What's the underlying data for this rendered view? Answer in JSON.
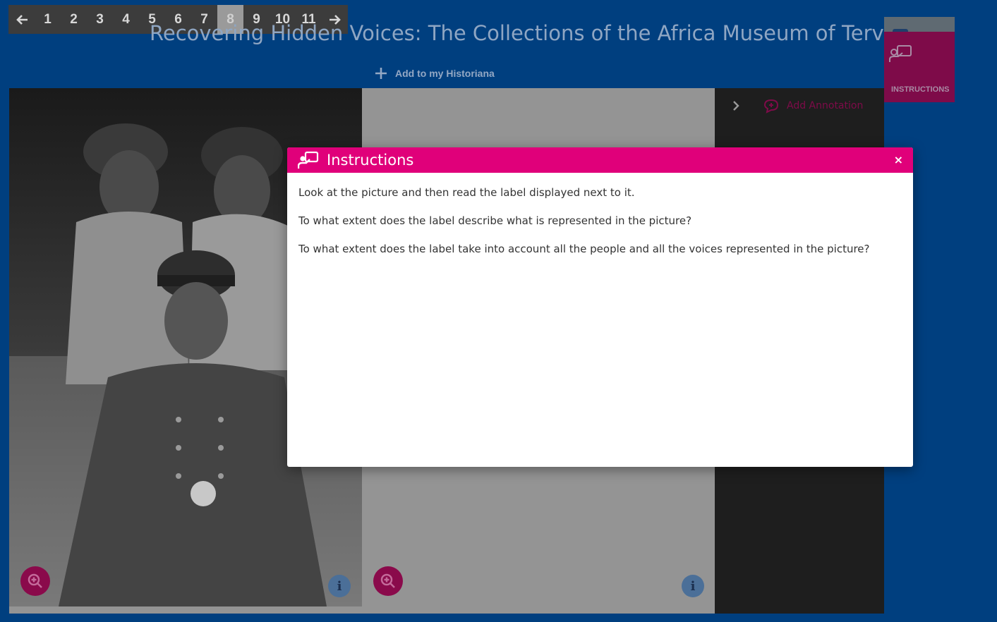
{
  "pager": {
    "prev_icon": "arrow-left-icon",
    "next_icon": "arrow-right-icon",
    "pages": [
      "1",
      "2",
      "3",
      "4",
      "5",
      "6",
      "7",
      "8",
      "9",
      "10",
      "11"
    ],
    "active_page": "8"
  },
  "header": {
    "title": "Recovering Hidden Voices: The Collections of the Africa Museum of Tervuren",
    "add_to_historiana": "Add to my Historiana"
  },
  "side_tab": {
    "label": "INSTRUCTIONS",
    "icon": "presenter-icon"
  },
  "viewer": {
    "left_image_alt": "Black-and-white photograph of a man in uniform seated, with two women standing behind him",
    "annotation_label": "Add Annotation",
    "info_label": "i"
  },
  "modal": {
    "title": "Instructions",
    "close_label": "×",
    "paragraphs": [
      "Look at the picture and then read the label displayed next to it.",
      "To what extent does the label describe what is represented in the picture?",
      "To what extent does the label take into account all the people and all the voices represented in the picture?"
    ]
  },
  "colors": {
    "background": "#003f7f",
    "modal_header": "#e0007a",
    "side_tab": "#7e0b49",
    "zoom_button": "#8a0a4b"
  }
}
